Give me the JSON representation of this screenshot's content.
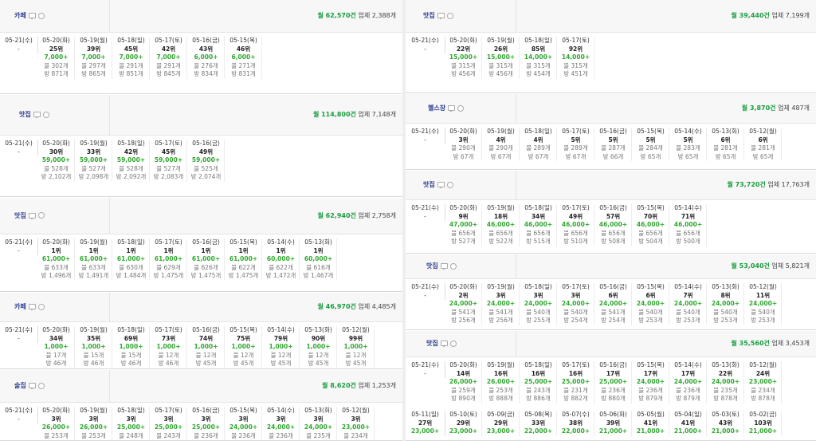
{
  "left_blocks": [
    {
      "category": "카페",
      "summary_monthly": "월 62,570건",
      "summary_biz": "업체 2,388개",
      "today": {
        "date": "05-21(수)",
        "dash": "-"
      },
      "cells": [
        {
          "d": "05-20(화)",
          "r": "25위",
          "v": "7,000+",
          "b": "블 302개",
          "p": "방 871개"
        },
        {
          "d": "05-19(월)",
          "r": "39위",
          "v": "7,000+",
          "b": "블 297개",
          "p": "방 865개"
        },
        {
          "d": "05-18(일)",
          "r": "45위",
          "v": "7,000+",
          "b": "블 291개",
          "p": "방 851개"
        },
        {
          "d": "05-17(토)",
          "r": "42위",
          "v": "7,000+",
          "b": "블 291개",
          "p": "방 845개"
        },
        {
          "d": "05-16(금)",
          "r": "43위",
          "v": "6,000+",
          "b": "블 276개",
          "p": "방 834개"
        },
        {
          "d": "05-15(목)",
          "r": "46위",
          "v": "6,000+",
          "b": "블 271개",
          "p": "방 831개"
        }
      ]
    },
    {
      "category": "맛집",
      "summary_monthly": "월 114,800건",
      "summary_biz": "업체 7,148개",
      "today": {
        "date": "05-21(수)",
        "dash": "-"
      },
      "cells": [
        {
          "d": "05-20(화)",
          "r": "30위",
          "v": "59,000+",
          "b": "블 528개",
          "p": "방 2,102개"
        },
        {
          "d": "05-19(월)",
          "r": "33위",
          "v": "59,000+",
          "b": "블 527개",
          "p": "방 2,098개"
        },
        {
          "d": "05-18(일)",
          "r": "42위",
          "v": "59,000+",
          "b": "블 528개",
          "p": "방 2,092개"
        },
        {
          "d": "05-17(토)",
          "r": "45위",
          "v": "59,000+",
          "b": "블 527개",
          "p": "방 2,083개"
        },
        {
          "d": "05-16(금)",
          "r": "49위",
          "v": "59,000+",
          "b": "블 525개",
          "p": "방 2,074개"
        }
      ]
    },
    {
      "category": "맛집",
      "summary_monthly": "월 62,940건",
      "summary_biz": "업체 2,758개",
      "today": {
        "date": "05-21(수)",
        "dash": "-"
      },
      "cells": [
        {
          "d": "05-20(화)",
          "r": "1위",
          "v": "61,000+",
          "b": "블 633개",
          "p": "방 1,496개"
        },
        {
          "d": "05-19(월)",
          "r": "1위",
          "v": "61,000+",
          "b": "블 633개",
          "p": "방 1,491개"
        },
        {
          "d": "05-18(일)",
          "r": "1위",
          "v": "61,000+",
          "b": "블 630개",
          "p": "방 1,484개"
        },
        {
          "d": "05-17(토)",
          "r": "1위",
          "v": "61,000+",
          "b": "블 629개",
          "p": "방 1,475개"
        },
        {
          "d": "05-16(금)",
          "r": "1위",
          "v": "61,000+",
          "b": "블 626개",
          "p": "방 1,475개"
        },
        {
          "d": "05-15(목)",
          "r": "1위",
          "v": "61,000+",
          "b": "블 622개",
          "p": "방 1,475개"
        },
        {
          "d": "05-14(수)",
          "r": "1위",
          "v": "60,000+",
          "b": "블 622개",
          "p": "방 1,472개"
        },
        {
          "d": "05-13(화)",
          "r": "1위",
          "v": "60,000+",
          "b": "블 616개",
          "p": "방 1,467개"
        }
      ]
    },
    {
      "category": "카페",
      "summary_monthly": "월 46,970건",
      "summary_biz": "업체 4,485개",
      "today": {
        "date": "05-21(수)",
        "dash": "-"
      },
      "cells": [
        {
          "d": "05-20(화)",
          "r": "34위",
          "v": "1,000+",
          "b": "블 17개",
          "p": "방 46개"
        },
        {
          "d": "05-19(월)",
          "r": "35위",
          "v": "1,000+",
          "b": "블 15개",
          "p": "방 46개"
        },
        {
          "d": "05-18(일)",
          "r": "69위",
          "v": "1,000+",
          "b": "블 15개",
          "p": "방 46개"
        },
        {
          "d": "05-17(토)",
          "r": "73위",
          "v": "1,000+",
          "b": "블 12개",
          "p": "방 46개"
        },
        {
          "d": "05-16(금)",
          "r": "74위",
          "v": "1,000+",
          "b": "블 12개",
          "p": "방 45개"
        },
        {
          "d": "05-15(목)",
          "r": "75위",
          "v": "1,000+",
          "b": "블 12개",
          "p": "방 45개"
        },
        {
          "d": "05-14(수)",
          "r": "79위",
          "v": "1,000+",
          "b": "블 12개",
          "p": "방 45개"
        },
        {
          "d": "05-13(화)",
          "r": "90위",
          "v": "1,000+",
          "b": "블 12개",
          "p": "방 45개"
        },
        {
          "d": "05-12(월)",
          "r": "99위",
          "v": "1,000+",
          "b": "블 12개",
          "p": "방 45개"
        }
      ]
    },
    {
      "category": "술집",
      "summary_monthly": "월 8,620건",
      "summary_biz": "업체 1,253개",
      "today": {
        "date": "05-21(수)",
        "dash": "-"
      },
      "cells": [
        {
          "d": "05-20(화)",
          "r": "3위",
          "v": "26,000+",
          "b": "블 253개",
          "p": ""
        },
        {
          "d": "05-19(월)",
          "r": "3위",
          "v": "26,000+",
          "b": "블 253개",
          "p": ""
        },
        {
          "d": "05-18(일)",
          "r": "3위",
          "v": "25,000+",
          "b": "블 248개",
          "p": ""
        },
        {
          "d": "05-17(토)",
          "r": "3위",
          "v": "25,000+",
          "b": "블 243개",
          "p": ""
        },
        {
          "d": "05-16(금)",
          "r": "3위",
          "v": "25,000+",
          "b": "블 236개",
          "p": ""
        },
        {
          "d": "05-15(목)",
          "r": "3위",
          "v": "24,000+",
          "b": "블 236개",
          "p": ""
        },
        {
          "d": "05-14(수)",
          "r": "3위",
          "v": "24,000+",
          "b": "블 236개",
          "p": ""
        },
        {
          "d": "05-13(화)",
          "r": "3위",
          "v": "24,000+",
          "b": "블 235개",
          "p": ""
        },
        {
          "d": "05-12(월)",
          "r": "3위",
          "v": "23,000+",
          "b": "블 234개",
          "p": ""
        }
      ]
    }
  ],
  "right_blocks": [
    {
      "category": "맛집",
      "summary_monthly": "월 39,440건",
      "summary_biz": "업체 7,199개",
      "today": {
        "date": "05-21(수)",
        "dash": "-"
      },
      "cells": [
        {
          "d": "05-20(화)",
          "r": "22위",
          "v": "15,000+",
          "b": "블 315개",
          "p": "방 456개"
        },
        {
          "d": "05-19(월)",
          "r": "26위",
          "v": "15,000+",
          "b": "블 315개",
          "p": "방 456개"
        },
        {
          "d": "05-18(일)",
          "r": "85위",
          "v": "14,000+",
          "b": "블 315개",
          "p": "방 454개"
        },
        {
          "d": "05-17(토)",
          "r": "92위",
          "v": "14,000+",
          "b": "블 315개",
          "p": "방 451개"
        }
      ]
    },
    {
      "category": "헬스장",
      "summary_monthly": "월 3,870건",
      "summary_biz": "업체 487개",
      "today": {
        "date": "05-21(수)",
        "dash": "-"
      },
      "cells": [
        {
          "d": "05-20(화)",
          "r": "3위",
          "v": "",
          "b": "블 290개",
          "p": "방 67개"
        },
        {
          "d": "05-19(월)",
          "r": "4위",
          "v": "",
          "b": "블 290개",
          "p": "방 67개"
        },
        {
          "d": "05-18(일)",
          "r": "4위",
          "v": "",
          "b": "블 289개",
          "p": "방 67개"
        },
        {
          "d": "05-17(토)",
          "r": "5위",
          "v": "",
          "b": "블 289개",
          "p": "방 67개"
        },
        {
          "d": "05-16(금)",
          "r": "5위",
          "v": "",
          "b": "블 287개",
          "p": "방 66개"
        },
        {
          "d": "05-15(목)",
          "r": "5위",
          "v": "",
          "b": "블 284개",
          "p": "방 65개"
        },
        {
          "d": "05-14(수)",
          "r": "5위",
          "v": "",
          "b": "블 283개",
          "p": "방 65개"
        },
        {
          "d": "05-13(화)",
          "r": "6위",
          "v": "",
          "b": "블 281개",
          "p": "방 65개"
        },
        {
          "d": "05-12(월)",
          "r": "6위",
          "v": "",
          "b": "블 281개",
          "p": "방 65개"
        }
      ]
    },
    {
      "category": "맛집",
      "summary_monthly": "월 73,720건",
      "summary_biz": "업체 17,763개",
      "today": {
        "date": "05-21(수)",
        "dash": "-"
      },
      "cells": [
        {
          "d": "05-20(화)",
          "r": "9위",
          "v": "47,000+",
          "b": "블 656개",
          "p": "방 527개"
        },
        {
          "d": "05-19(월)",
          "r": "18위",
          "v": "46,000+",
          "b": "블 656개",
          "p": "방 522개"
        },
        {
          "d": "05-18(일)",
          "r": "34위",
          "v": "46,000+",
          "b": "블 656개",
          "p": "방 515개"
        },
        {
          "d": "05-17(토)",
          "r": "49위",
          "v": "46,000+",
          "b": "블 656개",
          "p": "방 510개"
        },
        {
          "d": "05-16(금)",
          "r": "57위",
          "v": "46,000+",
          "b": "블 656개",
          "p": "방 508개"
        },
        {
          "d": "05-15(목)",
          "r": "70위",
          "v": "46,000+",
          "b": "블 656개",
          "p": "방 504개"
        },
        {
          "d": "05-14(수)",
          "r": "71위",
          "v": "46,000+",
          "b": "블 656개",
          "p": "방 500개"
        }
      ]
    },
    {
      "category": "맛집",
      "summary_monthly": "월 53,040건",
      "summary_biz": "업체 5,821개",
      "today": {
        "date": "05-21(수)",
        "dash": "-"
      },
      "cells": [
        {
          "d": "05-20(화)",
          "r": "2위",
          "v": "24,000+",
          "b": "블 541개",
          "p": "방 256개"
        },
        {
          "d": "05-19(월)",
          "r": "3위",
          "v": "24,000+",
          "b": "블 541개",
          "p": "방 256개"
        },
        {
          "d": "05-18(일)",
          "r": "3위",
          "v": "24,000+",
          "b": "블 540개",
          "p": "방 255개"
        },
        {
          "d": "05-17(토)",
          "r": "3위",
          "v": "24,000+",
          "b": "블 540개",
          "p": "방 254개"
        },
        {
          "d": "05-16(금)",
          "r": "6위",
          "v": "24,000+",
          "b": "블 541개",
          "p": "방 254개"
        },
        {
          "d": "05-15(목)",
          "r": "6위",
          "v": "24,000+",
          "b": "블 540개",
          "p": "방 253개"
        },
        {
          "d": "05-14(수)",
          "r": "7위",
          "v": "24,000+",
          "b": "블 540개",
          "p": "방 253개"
        },
        {
          "d": "05-13(화)",
          "r": "8위",
          "v": "24,000+",
          "b": "블 540개",
          "p": "방 253개"
        },
        {
          "d": "05-12(월)",
          "r": "11위",
          "v": "24,000+",
          "b": "블 540개",
          "p": "방 253개"
        }
      ]
    },
    {
      "category": "맛집",
      "summary_monthly": "월 35,560건",
      "summary_biz": "업체 3,453개",
      "today": {
        "date": "05-21(수)",
        "dash": "-"
      },
      "cells": [
        {
          "d": "05-20(화)",
          "r": "14위",
          "v": "26,000+",
          "b": "블 259개",
          "p": "방 890개"
        },
        {
          "d": "05-19(월)",
          "r": "16위",
          "v": "26,000+",
          "b": "블 253개",
          "p": "방 888개"
        },
        {
          "d": "05-18(일)",
          "r": "16위",
          "v": "25,000+",
          "b": "블 243개",
          "p": "방 886개"
        },
        {
          "d": "05-17(토)",
          "r": "16위",
          "v": "25,000+",
          "b": "블 231개",
          "p": "방 882개"
        },
        {
          "d": "05-16(금)",
          "r": "17위",
          "v": "25,000+",
          "b": "블 236개",
          "p": "방 880개"
        },
        {
          "d": "05-15(목)",
          "r": "17위",
          "v": "24,000+",
          "b": "블 236개",
          "p": "방 879개"
        },
        {
          "d": "05-14(수)",
          "r": "17위",
          "v": "24,000+",
          "b": "블 236개",
          "p": "방 879개"
        },
        {
          "d": "05-13(화)",
          "r": "22위",
          "v": "24,000+",
          "b": "블 235개",
          "p": "방 878개"
        },
        {
          "d": "05-12(월)",
          "r": "24위",
          "v": "23,000+",
          "b": "블 234개",
          "p": "방 878개"
        }
      ],
      "cells2": [
        {
          "d": "05-11(일)",
          "r": "27위",
          "v": "23,000+"
        },
        {
          "d": "05-10(토)",
          "r": "29위",
          "v": "23,000+"
        },
        {
          "d": "05-09(금)",
          "r": "29위",
          "v": "23,000+"
        },
        {
          "d": "05-08(목)",
          "r": "33위",
          "v": "22,000+"
        },
        {
          "d": "05-07(수)",
          "r": "38위",
          "v": "22,000+"
        },
        {
          "d": "05-06(화)",
          "r": "39위",
          "v": "21,000+"
        },
        {
          "d": "05-05(월)",
          "r": "41위",
          "v": "21,000+"
        },
        {
          "d": "05-04(일)",
          "r": "41위",
          "v": "21,000+"
        },
        {
          "d": "05-03(토)",
          "r": "43위",
          "v": "21,000+"
        },
        {
          "d": "05-02(금)",
          "r": "103위",
          "v": "21,000+"
        }
      ]
    }
  ]
}
